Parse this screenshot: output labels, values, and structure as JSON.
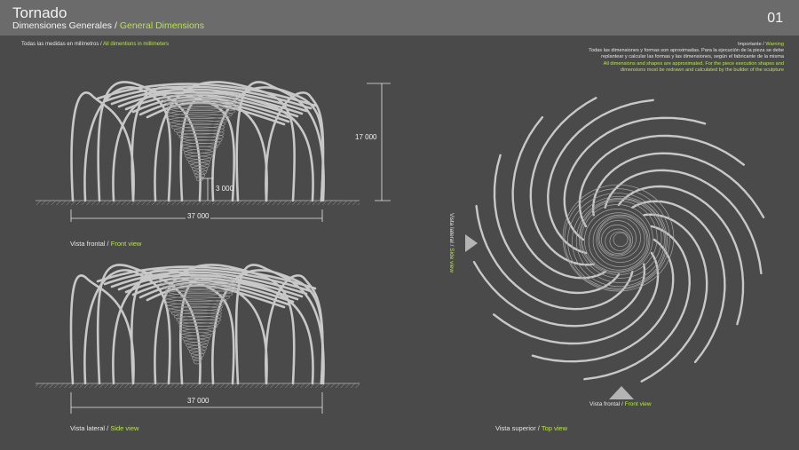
{
  "header": {
    "title": "Tornado",
    "subtitle_es": "Dimensiones Generales",
    "subtitle_sep": " / ",
    "subtitle_en": "General Dimensions",
    "page_number": "01"
  },
  "measures_note": {
    "es": "Todas las medidas en milímetros",
    "sep": " / ",
    "en": "All dimentions in millimeters"
  },
  "warning": {
    "title_es": "Importante",
    "sep": " / ",
    "title_en": "Warning",
    "text_es_1": "Todas las dimensiones y formas son aproximadas. Para la ejecución de la pieza se debe",
    "text_es_2": "replantear y calcular las formas y las dimensiones, según el fabricante de la misma",
    "text_en_1": "All dimensions and shapes are approximated. For the piece execution shapes and",
    "text_en_2": "dimensions most be redrawn and calculated by the builder of the sculpture"
  },
  "front_view": {
    "label_es": "Vista frontal",
    "sep": " / ",
    "label_en": "Front view",
    "height_dim": "17 000",
    "clearance_dim": "3 000",
    "width_dim": "37 000"
  },
  "side_view": {
    "label_es": "Vista lateral",
    "sep": " / ",
    "label_en": "Side view",
    "width_dim": "37 000"
  },
  "top_view": {
    "label_es": "Vista superior",
    "sep": " / ",
    "label_en": "Top view",
    "side_arrow_es": "Vista lateral",
    "side_arrow_sep": " / ",
    "side_arrow_en": "Side view",
    "front_arrow_es": "Vista frontal",
    "front_arrow_sep": " / ",
    "front_arrow_en": "Front view"
  },
  "colors": {
    "background": "#4a4a4a",
    "header": "#6b6b6b",
    "accent": "#b7e34a",
    "structure": "#c8c8c8"
  }
}
